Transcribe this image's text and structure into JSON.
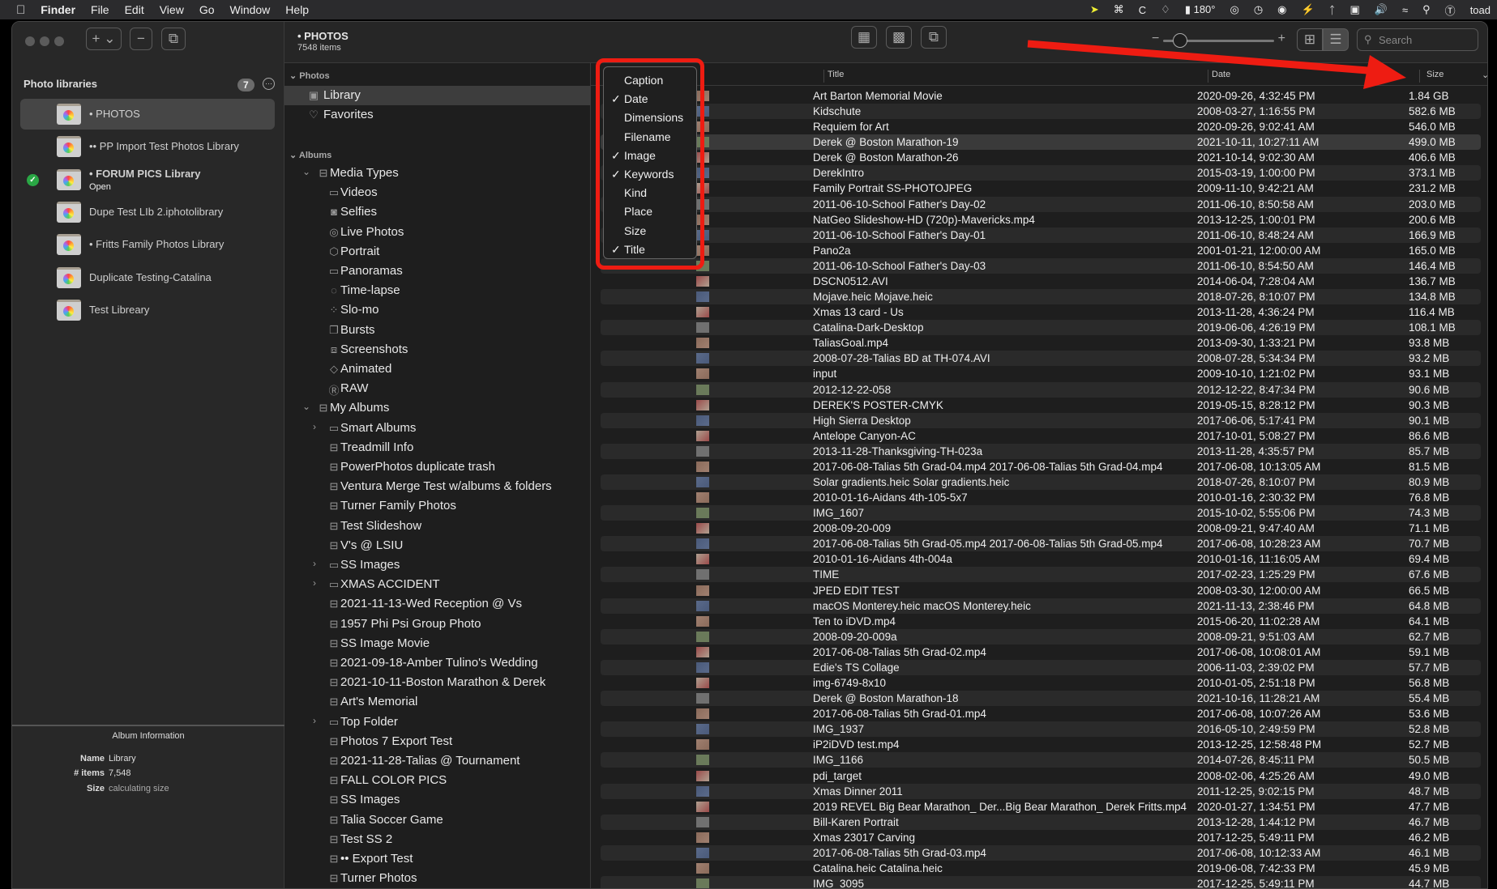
{
  "menubar": {
    "app": "Finder",
    "items": [
      "File",
      "Edit",
      "View",
      "Go",
      "Window",
      "Help"
    ],
    "temperature": "180°",
    "user": "toad"
  },
  "header": {
    "title": "• PHOTOS",
    "count": "7548 items"
  },
  "toolbar": {
    "search_placeholder": "Search",
    "zoom_level": 0.1,
    "view_mode": "list"
  },
  "libraries": {
    "title": "Photo libraries",
    "count": "7",
    "items": [
      {
        "name": "• PHOTOS",
        "selected": true
      },
      {
        "name": "•• PP Import Test Photos Library"
      },
      {
        "name": "• FORUM PICS Library",
        "status": "Open",
        "open": true
      },
      {
        "name": "Dupe Test LIb 2.iphotolibrary"
      },
      {
        "name": "• Fritts Family Photos Library"
      },
      {
        "name": "Duplicate Testing-Catalina"
      },
      {
        "name": "Test Libreary"
      }
    ]
  },
  "album_info": {
    "title": "Album Information",
    "name_label": "Name",
    "name": "Library",
    "items_label": "# items",
    "items": "7,548",
    "size_label": "Size",
    "size": "calculating size"
  },
  "tree": {
    "photos_header": "Photos",
    "albums_header": "Albums",
    "photos": [
      {
        "label": "Library",
        "icon": "library-icon",
        "selected": true
      },
      {
        "label": "Favorites",
        "icon": "heart-icon"
      }
    ],
    "items": [
      {
        "label": "Media Types",
        "level": 0,
        "chev": "open",
        "icon": "album-stack"
      },
      {
        "label": "Videos",
        "level": 1,
        "icon": "video"
      },
      {
        "label": "Selfies",
        "level": 1,
        "icon": "selfie"
      },
      {
        "label": "Live Photos",
        "level": 1,
        "icon": "live"
      },
      {
        "label": "Portrait",
        "level": 1,
        "icon": "cube"
      },
      {
        "label": "Panoramas",
        "level": 1,
        "icon": "pano"
      },
      {
        "label": "Time-lapse",
        "level": 1,
        "icon": "timelapse"
      },
      {
        "label": "Slo-mo",
        "level": 1,
        "icon": "slomo"
      },
      {
        "label": "Bursts",
        "level": 1,
        "icon": "bursts"
      },
      {
        "label": "Screenshots",
        "level": 1,
        "icon": "screenshot"
      },
      {
        "label": "Animated",
        "level": 1,
        "icon": "animated"
      },
      {
        "label": "RAW",
        "level": 1,
        "icon": "raw"
      },
      {
        "label": "My Albums",
        "level": 0,
        "chev": "open",
        "icon": "album-stack"
      },
      {
        "label": "Smart Albums",
        "level": 1,
        "chev": "closed",
        "icon": "folder"
      },
      {
        "label": "Treadmill Info",
        "level": 1,
        "icon": "album"
      },
      {
        "label": "PowerPhotos duplicate trash",
        "level": 1,
        "icon": "album"
      },
      {
        "label": "Ventura Merge Test w/albums & folders",
        "level": 1,
        "icon": "album"
      },
      {
        "label": "Turner Family Photos",
        "level": 1,
        "icon": "album"
      },
      {
        "label": "Test Slideshow",
        "level": 1,
        "icon": "album"
      },
      {
        "label": "V's @  LSIU",
        "level": 1,
        "icon": "album"
      },
      {
        "label": "SS Images",
        "level": 1,
        "chev": "closed",
        "icon": "folder"
      },
      {
        "label": "XMAS ACCIDENT",
        "level": 1,
        "chev": "closed",
        "icon": "folder"
      },
      {
        "label": "2021-11-13-Wed Reception @ Vs",
        "level": 1,
        "icon": "album"
      },
      {
        "label": "1957 Phi Psi Group Photo",
        "level": 1,
        "icon": "album"
      },
      {
        "label": "SS Image Movie",
        "level": 1,
        "icon": "album"
      },
      {
        "label": "2021-09-18-Amber Tulino's Wedding",
        "level": 1,
        "icon": "album"
      },
      {
        "label": "2021-10-11-Boston Marathon & Derek",
        "level": 1,
        "icon": "album"
      },
      {
        "label": "Art's Memorial",
        "level": 1,
        "icon": "album"
      },
      {
        "label": "Top Folder",
        "level": 1,
        "chev": "closed",
        "icon": "folder"
      },
      {
        "label": "Photos 7 Export Test",
        "level": 1,
        "icon": "album"
      },
      {
        "label": "2021-11-28-Talias @ Tournament",
        "level": 1,
        "icon": "album"
      },
      {
        "label": "FALL COLOR PICS",
        "level": 1,
        "icon": "album"
      },
      {
        "label": "SS Images",
        "level": 1,
        "icon": "album"
      },
      {
        "label": "Talia Soccer Game",
        "level": 1,
        "icon": "album"
      },
      {
        "label": "Test SS 2",
        "level": 1,
        "icon": "album"
      },
      {
        "label": "•• Export Test",
        "level": 1,
        "icon": "album"
      },
      {
        "label": "Turner Photos",
        "level": 1,
        "icon": "album"
      }
    ]
  },
  "columns_menu": [
    {
      "label": "Caption",
      "checked": false
    },
    {
      "label": "Date",
      "checked": true
    },
    {
      "label": "Dimensions",
      "checked": false
    },
    {
      "label": "Filename",
      "checked": false
    },
    {
      "label": "Image",
      "checked": true
    },
    {
      "label": "Keywords",
      "checked": true
    },
    {
      "label": "Kind",
      "checked": false
    },
    {
      "label": "Place",
      "checked": false
    },
    {
      "label": "Size",
      "checked": false
    },
    {
      "label": "Title",
      "checked": true
    }
  ],
  "table": {
    "columns": {
      "title": "Title",
      "date": "Date",
      "size": "Size"
    },
    "sort": "size-descending",
    "rows": [
      [
        "Art Barton Memorial Movie",
        "2020-09-26, 4:32:45 PM",
        "1.84 GB"
      ],
      [
        "Kidschute",
        "2008-03-27, 1:16:55 PM",
        "582.6 MB"
      ],
      [
        "Requiem for Art",
        "2020-09-26, 9:02:41 AM",
        "546.0 MB"
      ],
      [
        "Derek @ Boston Marathon-19",
        "2021-10-11, 10:27:11 AM",
        "499.0 MB"
      ],
      [
        "Derek @ Boston Marathon-26",
        "2021-10-14, 9:02:30 AM",
        "406.6 MB"
      ],
      [
        "DerekIntro",
        "2015-03-19, 1:00:00 PM",
        "373.1 MB"
      ],
      [
        "Family Portrait SS-PHOTOJPEG",
        "2009-11-10, 9:42:21 AM",
        "231.2 MB"
      ],
      [
        "2011-06-10-School Father's Day-02",
        "2011-06-10, 8:50:58 AM",
        "203.0 MB"
      ],
      [
        "NatGeo Slideshow-HD (720p)-Mavericks.mp4",
        "2013-12-25, 1:00:01 PM",
        "200.6 MB"
      ],
      [
        "2011-06-10-School Father's Day-01",
        "2011-06-10, 8:48:24 AM",
        "166.9 MB"
      ],
      [
        "Pano2a",
        "2001-01-21, 12:00:00 AM",
        "165.0 MB"
      ],
      [
        "2011-06-10-School Father's Day-03",
        "2011-06-10, 8:54:50 AM",
        "146.4 MB"
      ],
      [
        "DSCN0512.AVI",
        "2014-06-04, 7:28:04 AM",
        "136.7 MB"
      ],
      [
        "Mojave.heic Mojave.heic",
        "2018-07-26, 8:10:07 PM",
        "134.8 MB"
      ],
      [
        "Xmas 13 card - Us",
        "2013-11-28, 4:36:24 PM",
        "116.4 MB"
      ],
      [
        "Catalina-Dark-Desktop",
        "2019-06-06, 4:26:19 PM",
        "108.1 MB"
      ],
      [
        "TaliasGoal.mp4",
        "2013-09-30, 1:33:21 PM",
        "93.8 MB"
      ],
      [
        "2008-07-28-Talias BD at TH-074.AVI",
        "2008-07-28, 5:34:34 PM",
        "93.2 MB"
      ],
      [
        "input",
        "2009-10-10, 1:21:02 PM",
        "93.1 MB"
      ],
      [
        "2012-12-22-058",
        "2012-12-22, 8:47:34 PM",
        "90.6 MB"
      ],
      [
        "DEREK'S POSTER-CMYK",
        "2019-05-15, 8:28:12 PM",
        "90.3 MB"
      ],
      [
        "High Sierra Desktop",
        "2017-06-06, 5:17:41 PM",
        "90.1 MB"
      ],
      [
        "Antelope Canyon-AC",
        "2017-10-01, 5:08:27 PM",
        "86.6 MB"
      ],
      [
        "2013-11-28-Thanksgiving-TH-023a",
        "2013-11-28, 4:35:57 PM",
        "85.7 MB"
      ],
      [
        "2017-06-08-Talias 5th Grad-04.mp4 2017-06-08-Talias 5th Grad-04.mp4",
        "2017-06-08, 10:13:05 AM",
        "81.5 MB"
      ],
      [
        "Solar gradients.heic Solar gradients.heic",
        "2018-07-26, 8:10:07 PM",
        "80.9 MB"
      ],
      [
        "2010-01-16-Aidans 4th-105-5x7",
        "2010-01-16, 2:30:32 PM",
        "76.8 MB"
      ],
      [
        "IMG_1607",
        "2015-10-02, 5:55:06 PM",
        "74.3 MB"
      ],
      [
        "2008-09-20-009",
        "2008-09-21, 9:47:40 AM",
        "71.1 MB"
      ],
      [
        "2017-06-08-Talias 5th Grad-05.mp4 2017-06-08-Talias 5th Grad-05.mp4",
        "2017-06-08, 10:28:23 AM",
        "70.7 MB"
      ],
      [
        "2010-01-16-Aidans 4th-004a",
        "2010-01-16, 11:16:05 AM",
        "69.4 MB"
      ],
      [
        "TIME",
        "2017-02-23, 1:25:29 PM",
        "67.6 MB"
      ],
      [
        "JPED EDIT TEST",
        "2008-03-30, 12:00:00 AM",
        "66.5 MB"
      ],
      [
        "macOS Monterey.heic macOS Monterey.heic",
        "2021-11-13, 2:38:46 PM",
        "64.8 MB"
      ],
      [
        "Ten to iDVD.mp4",
        "2015-06-20, 11:02:28 AM",
        "64.1 MB"
      ],
      [
        "2008-09-20-009a",
        "2008-09-21, 9:51:03 AM",
        "62.7 MB"
      ],
      [
        "2017-06-08-Talias 5th Grad-02.mp4",
        "2017-06-08, 10:08:01 AM",
        "59.1 MB"
      ],
      [
        "Edie's TS Collage",
        "2006-11-03, 2:39:02 PM",
        "57.7 MB"
      ],
      [
        "img-6749-8x10",
        "2010-01-05, 2:51:18 PM",
        "56.8 MB"
      ],
      [
        "Derek @ Boston Marathon-18",
        "2021-10-16, 11:28:21 AM",
        "55.4 MB"
      ],
      [
        "2017-06-08-Talias 5th Grad-01.mp4",
        "2017-06-08, 10:07:26 AM",
        "53.6 MB"
      ],
      [
        "IMG_1937",
        "2016-05-10, 2:49:59 PM",
        "52.8 MB"
      ],
      [
        "iP2iDVD test.mp4",
        "2013-12-25, 12:58:48 PM",
        "52.7 MB"
      ],
      [
        "IMG_1166",
        "2014-07-26, 8:45:11 PM",
        "50.5 MB"
      ],
      [
        "pdi_target",
        "2008-02-06, 4:25:26 AM",
        "49.0 MB"
      ],
      [
        "Xmas Dinner 2011",
        "2011-12-25, 9:02:15 PM",
        "48.7 MB"
      ],
      [
        "2019 REVEL Big Bear Marathon_ Der...Big Bear Marathon_ Derek Fritts.mp4",
        "2020-01-27, 1:34:51 PM",
        "47.7 MB"
      ],
      [
        "Bill-Karen Portrait",
        "2013-12-28, 1:44:12 PM",
        "46.7 MB"
      ],
      [
        "Xmas 23017 Carving",
        "2017-12-25, 5:49:11 PM",
        "46.2 MB"
      ],
      [
        "2017-06-08-Talias 5th Grad-03.mp4",
        "2017-06-08, 10:12:33 AM",
        "46.1 MB"
      ],
      [
        "Catalina.heic Catalina.heic",
        "2019-06-08, 7:42:33 PM",
        "45.9 MB"
      ],
      [
        "IMG_3095",
        "2017-12-25, 5:49:11 PM",
        "44.7 MB"
      ]
    ],
    "highlighted_row": 3
  },
  "colors": {
    "annotation": "#ee1c12",
    "open_check": "#2aa745"
  }
}
